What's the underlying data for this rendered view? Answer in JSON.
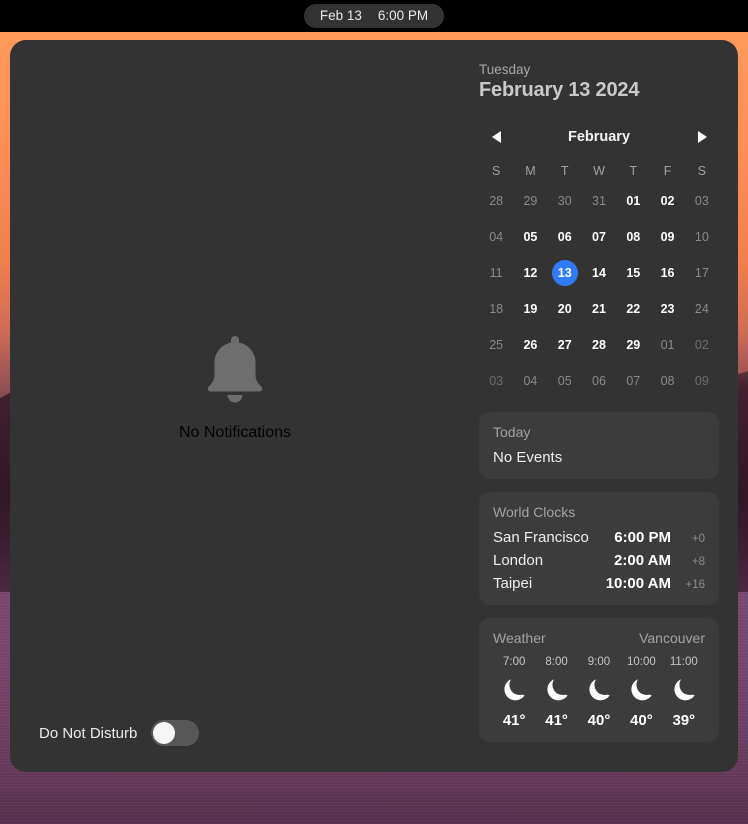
{
  "menubar": {
    "date_label": "Feb 13",
    "time_label": "6:00 PM"
  },
  "notifications": {
    "icon": "bell-icon",
    "empty_label": "No Notifications",
    "do_not_disturb_label": "Do Not Disturb",
    "do_not_disturb_on": false
  },
  "date_header": {
    "weekday": "Tuesday",
    "full_date": "February 13 2024"
  },
  "calendar": {
    "prev_icon": "chevron-left-icon",
    "next_icon": "chevron-right-icon",
    "month_label": "February",
    "day_headers": [
      "S",
      "M",
      "T",
      "W",
      "T",
      "F",
      "S"
    ],
    "weeks": [
      [
        {
          "d": "28",
          "state": "other"
        },
        {
          "d": "29",
          "state": "other"
        },
        {
          "d": "30",
          "state": "other"
        },
        {
          "d": "31",
          "state": "other"
        },
        {
          "d": "01",
          "state": "normal"
        },
        {
          "d": "02",
          "state": "normal"
        },
        {
          "d": "03",
          "state": "weekend"
        }
      ],
      [
        {
          "d": "04",
          "state": "weekend"
        },
        {
          "d": "05",
          "state": "normal"
        },
        {
          "d": "06",
          "state": "normal"
        },
        {
          "d": "07",
          "state": "normal"
        },
        {
          "d": "08",
          "state": "normal"
        },
        {
          "d": "09",
          "state": "normal"
        },
        {
          "d": "10",
          "state": "weekend"
        }
      ],
      [
        {
          "d": "11",
          "state": "weekend"
        },
        {
          "d": "12",
          "state": "normal"
        },
        {
          "d": "13",
          "state": "today"
        },
        {
          "d": "14",
          "state": "normal"
        },
        {
          "d": "15",
          "state": "normal"
        },
        {
          "d": "16",
          "state": "normal"
        },
        {
          "d": "17",
          "state": "weekend"
        }
      ],
      [
        {
          "d": "18",
          "state": "weekend"
        },
        {
          "d": "19",
          "state": "normal"
        },
        {
          "d": "20",
          "state": "normal"
        },
        {
          "d": "21",
          "state": "normal"
        },
        {
          "d": "22",
          "state": "normal"
        },
        {
          "d": "23",
          "state": "normal"
        },
        {
          "d": "24",
          "state": "weekend"
        }
      ],
      [
        {
          "d": "25",
          "state": "weekend"
        },
        {
          "d": "26",
          "state": "normal"
        },
        {
          "d": "27",
          "state": "normal"
        },
        {
          "d": "28",
          "state": "normal"
        },
        {
          "d": "29",
          "state": "normal"
        },
        {
          "d": "01",
          "state": "other"
        },
        {
          "d": "02",
          "state": "other2"
        }
      ],
      [
        {
          "d": "03",
          "state": "other2"
        },
        {
          "d": "04",
          "state": "other"
        },
        {
          "d": "05",
          "state": "other"
        },
        {
          "d": "06",
          "state": "other"
        },
        {
          "d": "07",
          "state": "other"
        },
        {
          "d": "08",
          "state": "other"
        },
        {
          "d": "09",
          "state": "other2"
        }
      ]
    ],
    "selected_day": "13",
    "accent_color": "#2f7cf6"
  },
  "events_card": {
    "title": "Today",
    "body": "No Events"
  },
  "world_clocks": {
    "title": "World Clocks",
    "rows": [
      {
        "city": "San Francisco",
        "time": "6:00 PM",
        "offset": "+0"
      },
      {
        "city": "London",
        "time": "2:00 AM",
        "offset": "+8"
      },
      {
        "city": "Taipei",
        "time": "10:00 AM",
        "offset": "+16"
      }
    ]
  },
  "weather": {
    "title": "Weather",
    "city": "Vancouver",
    "hours": [
      {
        "time": "7:00",
        "icon": "moon-icon",
        "temp": "41°"
      },
      {
        "time": "8:00",
        "icon": "moon-icon",
        "temp": "41°"
      },
      {
        "time": "9:00",
        "icon": "moon-icon",
        "temp": "40°"
      },
      {
        "time": "10:00",
        "icon": "moon-icon",
        "temp": "40°"
      },
      {
        "time": "11:00",
        "icon": "moon-icon",
        "temp": "39°"
      }
    ]
  }
}
